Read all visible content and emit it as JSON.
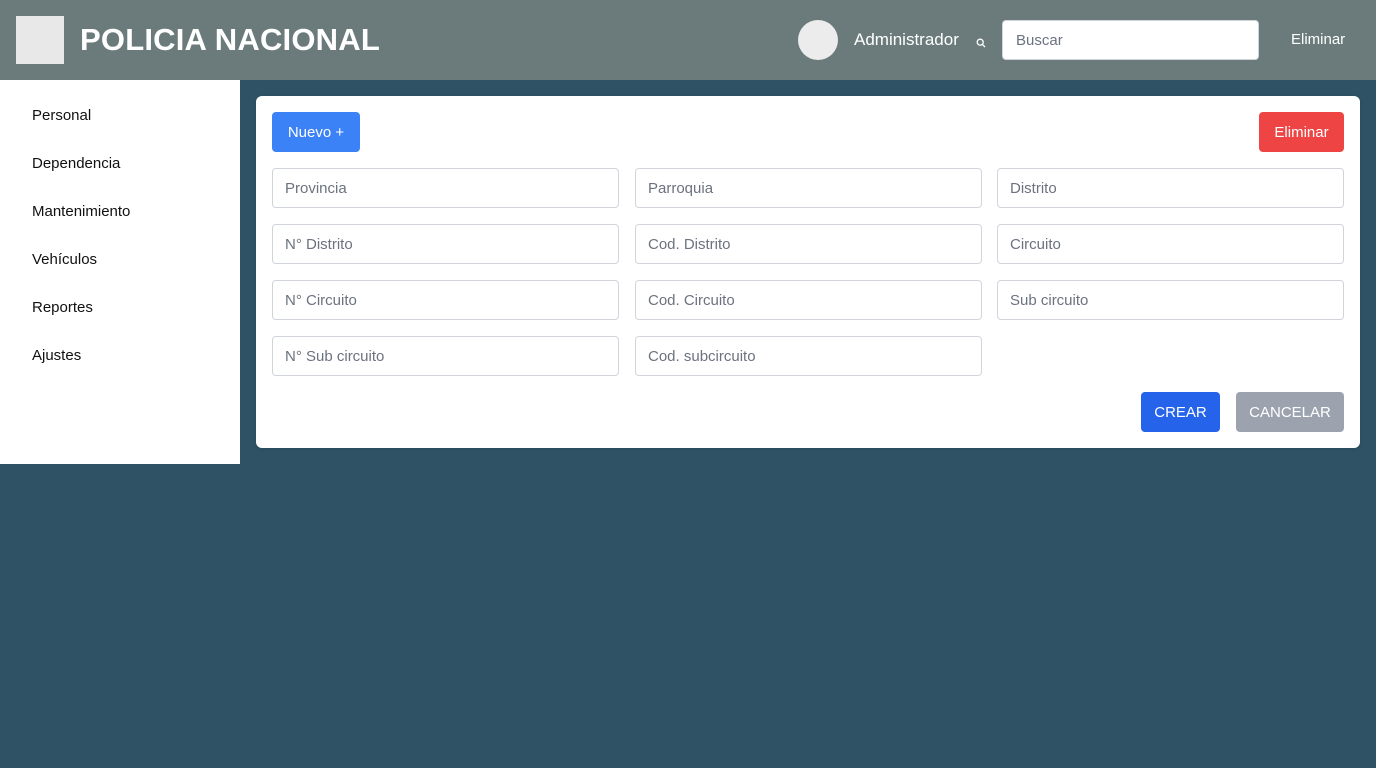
{
  "header": {
    "title": "POLICIA NACIONAL",
    "user_name": "Administrador",
    "search_placeholder": "Buscar",
    "link_label": "Eliminar"
  },
  "sidebar": {
    "items": [
      {
        "label": "Personal"
      },
      {
        "label": "Dependencia"
      },
      {
        "label": "Mantenimiento"
      },
      {
        "label": "Vehículos"
      },
      {
        "label": "Reportes"
      },
      {
        "label": "Ajustes"
      }
    ]
  },
  "form": {
    "new_label": "Nuevo +",
    "delete_label": "Eliminar",
    "create_label": "CREAR",
    "cancel_label": "CANCELAR",
    "fields": [
      {
        "placeholder": "Provincia",
        "value": ""
      },
      {
        "placeholder": "Parroquia",
        "value": ""
      },
      {
        "placeholder": "Distrito",
        "value": ""
      },
      {
        "placeholder": "N° Distrito",
        "value": ""
      },
      {
        "placeholder": "Cod. Distrito",
        "value": ""
      },
      {
        "placeholder": "Circuito",
        "value": ""
      },
      {
        "placeholder": "N° Circuito",
        "value": ""
      },
      {
        "placeholder": "Cod. Circuito",
        "value": ""
      },
      {
        "placeholder": "Sub circuito",
        "value": ""
      },
      {
        "placeholder": "N° Sub circuito",
        "value": ""
      },
      {
        "placeholder": "Cod. subcircuito",
        "value": ""
      }
    ]
  },
  "icons": {
    "search": "search-icon",
    "logo": "logo-image",
    "avatar": "avatar-image"
  },
  "colors": {
    "header_bg": "#6b7b7b",
    "page_bg": "#2f5365",
    "new_button": "#3b82f6",
    "delete_button": "#ef4444",
    "create_button": "#2563eb",
    "cancel_button": "#9ca3af"
  }
}
